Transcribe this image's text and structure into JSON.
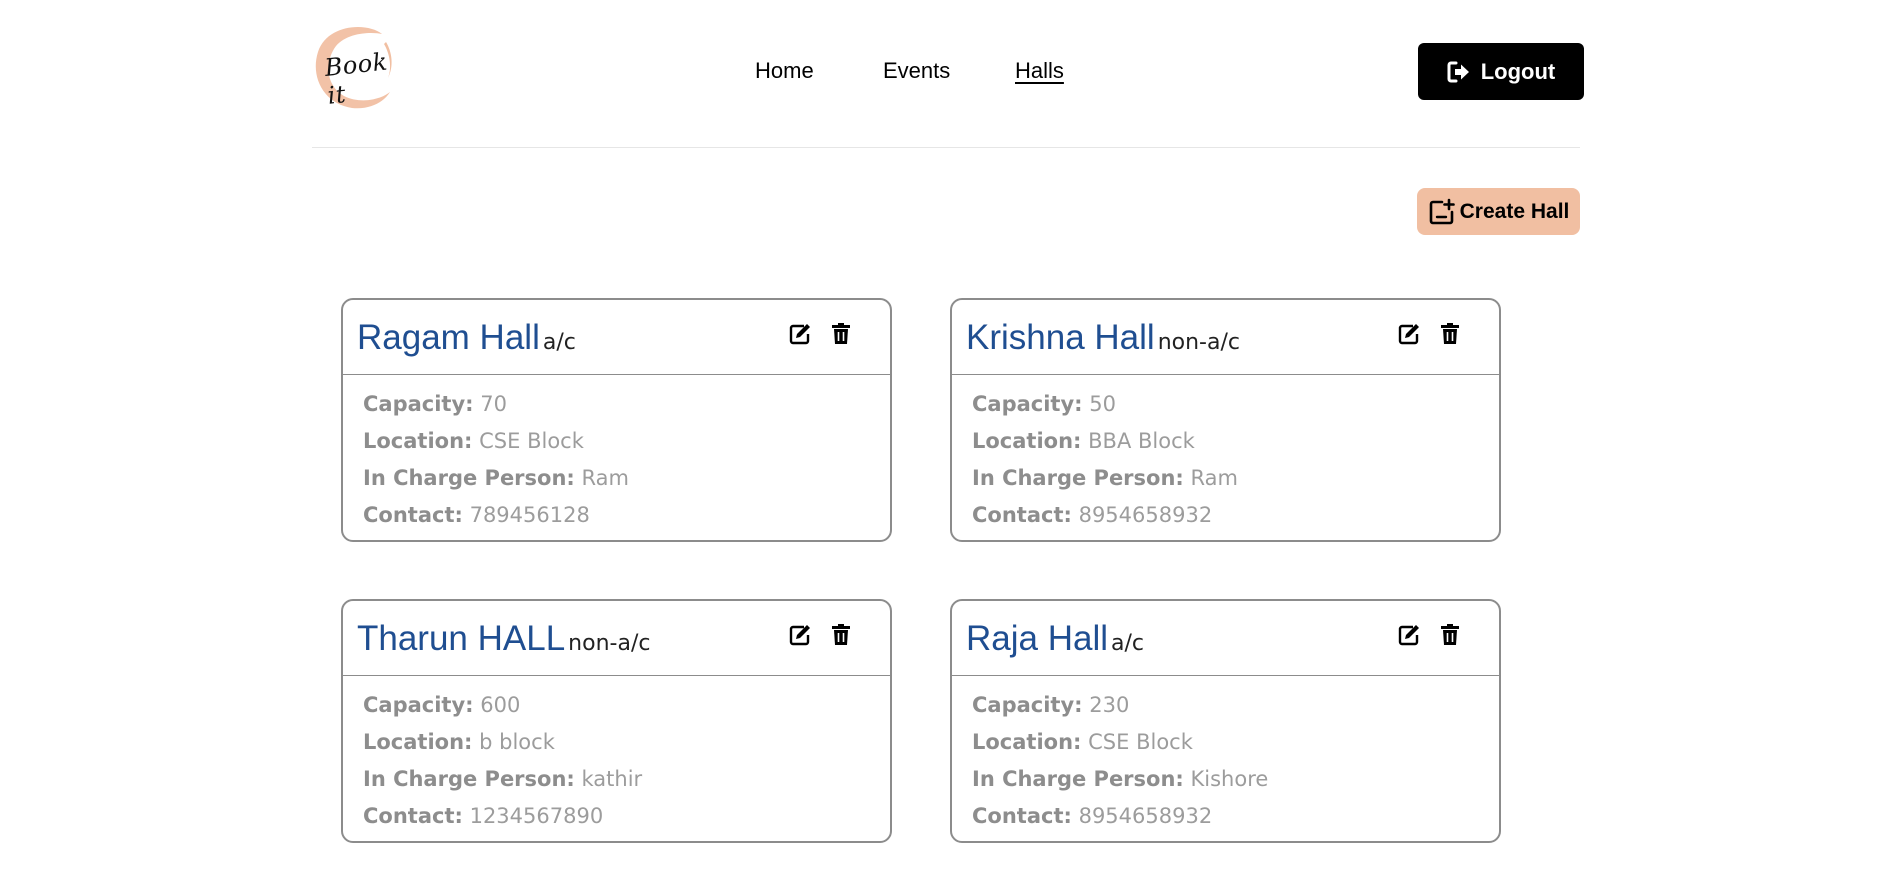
{
  "logo": {
    "text": "Book it",
    "ring_color": "#f1bfa2"
  },
  "nav": {
    "items": [
      {
        "label": "Home",
        "active": false
      },
      {
        "label": "Events",
        "active": false
      },
      {
        "label": "Halls",
        "active": true
      }
    ]
  },
  "header": {
    "logout_label": "Logout",
    "logout_icon": "sign-out-icon"
  },
  "toolbar": {
    "create_label": "Create Hall",
    "create_icon": "add-square-icon",
    "create_color": "#f1bfa2"
  },
  "labels": {
    "capacity": "Capacity:",
    "location": "Location:",
    "in_charge": "In Charge Person:",
    "contact": "Contact:"
  },
  "colors": {
    "hall_name": "#1f4e91",
    "detail_text": "#9c9c9c"
  },
  "halls": [
    {
      "name": "Ragam Hall",
      "type": "a/c",
      "capacity": "70",
      "location": "CSE Block",
      "in_charge": "Ram",
      "contact": "789456128"
    },
    {
      "name": "Krishna Hall",
      "type": "non-a/c",
      "capacity": "50",
      "location": "BBA Block",
      "in_charge": "Ram",
      "contact": "8954658932"
    },
    {
      "name": "Tharun HALL",
      "type": "non-a/c",
      "capacity": "600",
      "location": "b block",
      "in_charge": "kathir",
      "contact": "1234567890"
    },
    {
      "name": "Raja Hall",
      "type": "a/c",
      "capacity": "230",
      "location": "CSE Block",
      "in_charge": "Kishore",
      "contact": "8954658932"
    }
  ]
}
